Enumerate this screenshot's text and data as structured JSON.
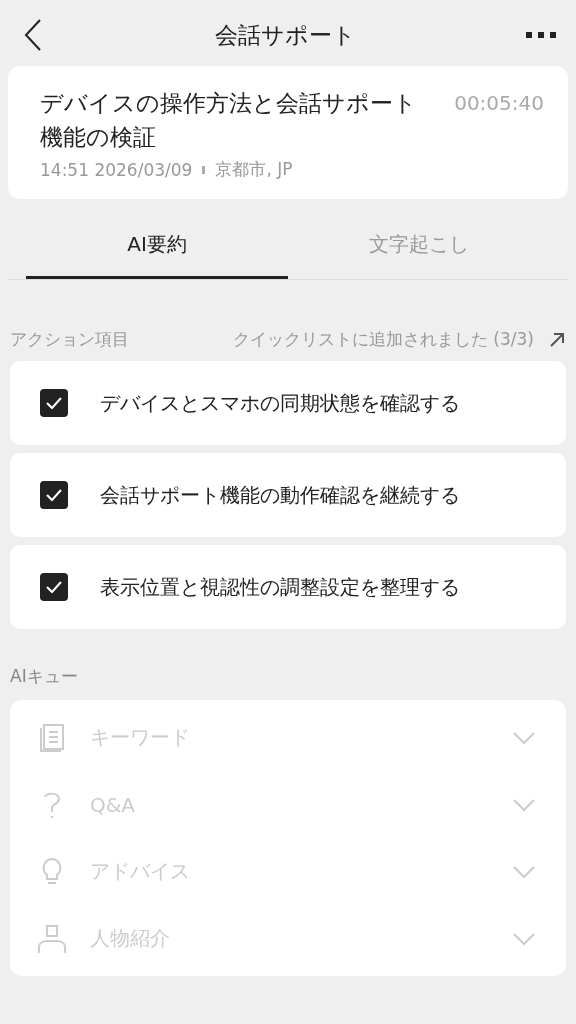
{
  "header": {
    "title": "会話サポート"
  },
  "recording": {
    "title": "デバイスの操作方法と会話サポート機能の検証",
    "duration": "00:05:40",
    "datetime": "14:51 2026/03/09",
    "location": "京都市, JP"
  },
  "tabs": [
    {
      "label": "AI要約",
      "selected": true
    },
    {
      "label": "文字起こし",
      "selected": false
    }
  ],
  "action_items": {
    "label": "アクション項目",
    "status": "クイックリストに追加されました (3/3)",
    "items": [
      {
        "text": "デバイスとスマホの同期状態を確認する",
        "checked": true
      },
      {
        "text": "会話サポート機能の動作確認を継続する",
        "checked": true
      },
      {
        "text": "表示位置と視認性の調整設定を整理する",
        "checked": true
      }
    ]
  },
  "ai_cues": {
    "label": "AIキュー",
    "items": [
      {
        "kind": "keywords",
        "label": "キーワード",
        "disabled": true
      },
      {
        "kind": "qa",
        "label": "Q&A",
        "disabled": true
      },
      {
        "kind": "advice",
        "label": "アドバイス",
        "disabled": true
      },
      {
        "kind": "person",
        "label": "人物紹介",
        "disabled": true
      }
    ]
  }
}
